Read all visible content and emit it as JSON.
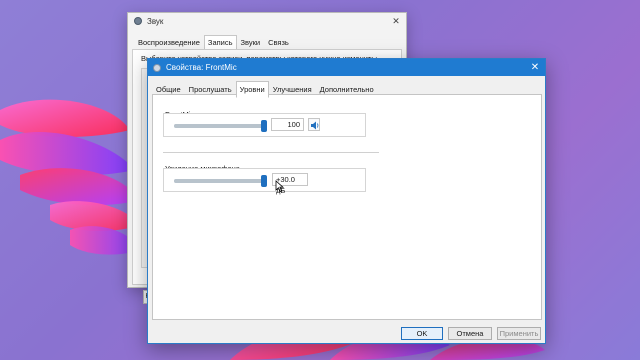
{
  "sound_window": {
    "title": "Звук",
    "close_glyph": "✕",
    "tabs": [
      "Воспроизведение",
      "Запись",
      "Звуки",
      "Связь"
    ],
    "active_tab": "Запись",
    "hint": "Выберите устройство записи, параметры которого нужно изменить:",
    "list_button_glyph": "Н"
  },
  "props_window": {
    "title": "Свойства: FrontMic",
    "close_glyph": "✕",
    "tabs": [
      "Общие",
      "Прослушать",
      "Уровни",
      "Улучшения",
      "Дополнительно"
    ],
    "active_tab": "Уровни",
    "device_level": {
      "label": "FrontMic",
      "value": "100",
      "level_fraction": 1.0
    },
    "boost": {
      "label": "Усиление микрофона",
      "value": "+30.0 дБ",
      "level_fraction": 1.0
    },
    "buttons": {
      "ok": "OK",
      "cancel": "Отмена",
      "apply": "Применить"
    }
  },
  "icons": {
    "speaker": "speaker-icon",
    "window_icon": "sound-device-icon",
    "cursor": "mouse-pointer-icon"
  },
  "colors": {
    "titlebar_active": "#1f7bd1",
    "slider_thumb": "#1f6fbf",
    "wallpaper": "#8f7fd6",
    "petal_pink": "#ff3d9a",
    "petal_red": "#ff2a55",
    "petal_blue": "#6a3dff"
  }
}
